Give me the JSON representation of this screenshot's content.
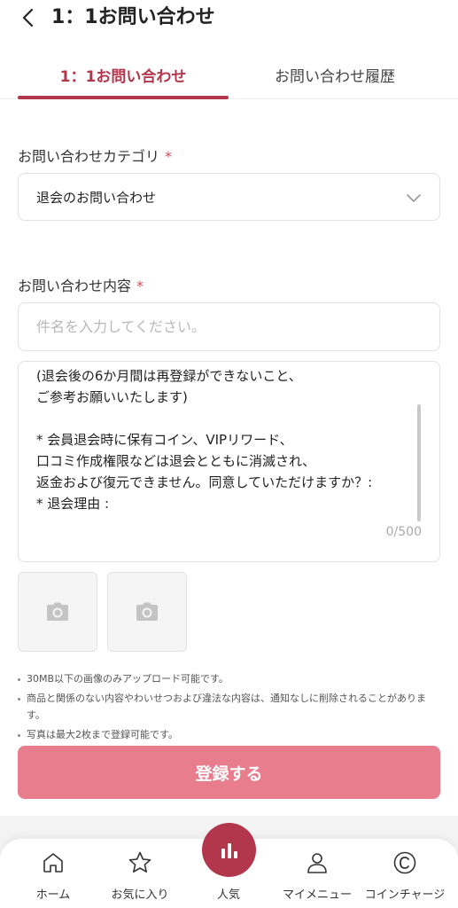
{
  "header": {
    "title": "1：1お問い合わせ"
  },
  "tabs": [
    {
      "label": "1：1お問い合わせ",
      "active": true
    },
    {
      "label": "お問い合わせ履歴",
      "active": false
    }
  ],
  "category": {
    "label": "お問い合わせカテゴリ",
    "required_mark": "*",
    "selected": "退会のお問い合わせ"
  },
  "content": {
    "label": "お問い合わせ内容",
    "required_mark": "*",
    "subject_placeholder": "件名を入力してください。",
    "body_text": "(退会後の6か月間は再登録ができないこと、\nご参考お願いいたします)\n\n* 会員退会時に保有コイン、VIPリワード、\n口コミ作成権限などは退会とともに消滅され、\n返金および復元できません。同意していただけますか？:\n* 退会理由 :",
    "counter": "0/500"
  },
  "notes": [
    "30MB以下の画像のみアップロード可能です。",
    "商品と関係のない内容やわいせつおよび違法な内容は、通知なしに削除されることがあります。",
    "写真は最大2枚まで登録可能です。"
  ],
  "submit_label": "登録する",
  "bottom_nav": [
    {
      "label": "ホーム",
      "icon": "home-icon"
    },
    {
      "label": "お気に入り",
      "icon": "star-icon"
    },
    {
      "label": "人気",
      "icon": "bar-chart-icon"
    },
    {
      "label": "マイメニュー",
      "icon": "person-icon"
    },
    {
      "label": "コインチャージ",
      "icon": "coin-icon"
    }
  ],
  "colors": {
    "accent": "#b2374c",
    "submit_button": "#e87d8d",
    "required_mark": "#d9485c"
  }
}
